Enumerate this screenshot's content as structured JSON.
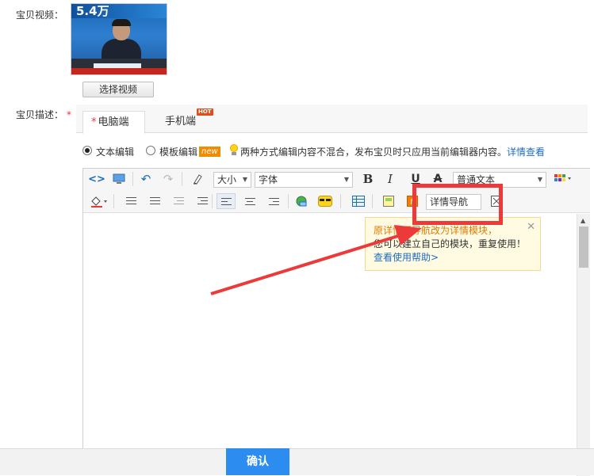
{
  "video": {
    "label": "宝贝视频：",
    "thumb_banner": "5.4万",
    "select_button": "选择视频"
  },
  "description": {
    "label": "宝贝描述：",
    "required_mark": "*",
    "tabs": [
      {
        "label": "电脑端",
        "required": "*"
      },
      {
        "label": "手机端"
      }
    ],
    "hot_badge": "HOT",
    "mode": {
      "text_edit": "文本编辑",
      "template_edit": "模板编辑",
      "new_badge": "new",
      "notice": "两种方式编辑内容不混合，发布宝贝时只应用当前编辑器内容。",
      "notice_link": "详情查看"
    }
  },
  "toolbar": {
    "size_dropdown": "大小",
    "font_dropdown": "字体",
    "bold": "B",
    "italic": "I",
    "underline": "U",
    "strike": "A",
    "format_dropdown": "普通文本",
    "detail_nav": "详情导航"
  },
  "tooltip": {
    "line1": "原详情页导航改为详情模块，",
    "line2": "您可以建立自己的模块，重复使用！",
    "help_link": "查看使用帮助>",
    "close": "✕"
  },
  "footer": {
    "confirm": "确认"
  },
  "colors": {
    "accent": "#2d8cf0",
    "annotation": "#ec3a3a",
    "required": "#e4393c"
  }
}
